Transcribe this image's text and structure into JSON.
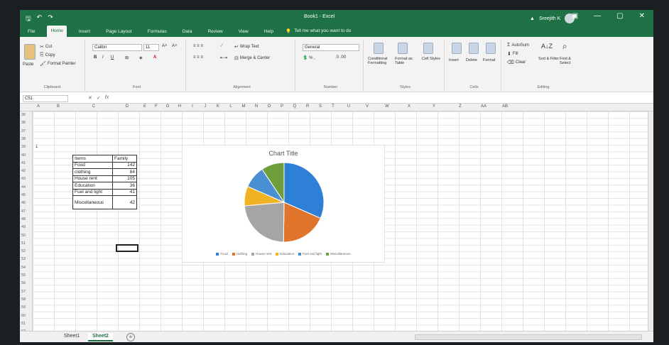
{
  "titlebar": {
    "doc_title": "Book1 - Excel",
    "user_name": "Sreejith K",
    "min": "—",
    "max": "▢",
    "close": "✕"
  },
  "menu": {
    "tabs": [
      "File",
      "Home",
      "Insert",
      "Page Layout",
      "Formulas",
      "Data",
      "Review",
      "View",
      "Help"
    ],
    "active": "Home",
    "tell_me": "Tell me what you want to do"
  },
  "ribbon": {
    "clipboard": {
      "paste": "Paste",
      "cut": "Cut",
      "copy": "Copy",
      "format_painter": "Format Painter",
      "group": "Clipboard"
    },
    "font": {
      "name": "Calibri",
      "size": "11",
      "group": "Font"
    },
    "alignment": {
      "wrap": "Wrap Text",
      "merge": "Merge & Center",
      "group": "Alignment"
    },
    "number": {
      "format": "General",
      "group": "Number"
    },
    "styles": {
      "conditional": "Conditional Formatting",
      "format_table": "Format as Table",
      "cell_styles": "Cell Styles",
      "group": "Styles"
    },
    "cells": {
      "insert": "Insert",
      "delete": "Delete",
      "format": "Format",
      "group": "Cells"
    },
    "editing": {
      "autosum": "AutoSum",
      "fill": "Fill",
      "clear": "Clear",
      "sort": "Sort & Filter",
      "find": "Find & Select",
      "group": "Editing"
    }
  },
  "formula_bar": {
    "name_box": "C51",
    "fx": "fx"
  },
  "columns": [
    "A",
    "B",
    "C",
    "D",
    "E",
    "F",
    "G",
    "H",
    "I",
    "J",
    "K",
    "L",
    "M",
    "N",
    "O",
    "P",
    "Q",
    "R",
    "S",
    "T",
    "U",
    "V",
    "W",
    "X",
    "Y",
    "Z",
    "AA",
    "AB"
  ],
  "rows": [
    "35",
    "36",
    "37",
    "38",
    "39",
    "40",
    "41",
    "42",
    "43",
    "44",
    "45",
    "46",
    "47",
    "48",
    "49",
    "50",
    "51",
    "52",
    "53",
    "54",
    "55",
    "56",
    "57",
    "58",
    "59",
    "60",
    "61",
    "62"
  ],
  "row39_value": "1",
  "table": {
    "header": {
      "item": "Items",
      "value": "Family"
    },
    "rows": [
      {
        "item": "Food",
        "value": "142"
      },
      {
        "item": "clothing",
        "value": "84"
      },
      {
        "item": "House rent",
        "value": "105"
      },
      {
        "item": "Education",
        "value": "36"
      },
      {
        "item": "Fuel and light",
        "value": "41"
      },
      {
        "item": "Miscellaneous",
        "value": "42"
      }
    ]
  },
  "chart_data": {
    "type": "pie",
    "title": "Chart Title",
    "categories": [
      "Food",
      "clothing",
      "House rent",
      "Education",
      "Fuel and light",
      "Miscellaneous"
    ],
    "values": [
      142,
      84,
      105,
      36,
      41,
      42
    ],
    "colors": [
      "#2e7fd6",
      "#e0742a",
      "#a5a5a5",
      "#f0b323",
      "#4a8fd4",
      "#6f9e3f"
    ],
    "legend": "bottom"
  },
  "sheets": {
    "tabs": [
      "Sheet1",
      "Sheet2"
    ],
    "active": "Sheet2",
    "add": "+"
  }
}
